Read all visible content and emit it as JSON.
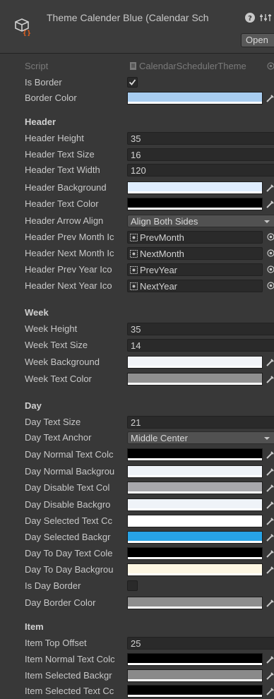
{
  "header": {
    "title": "Theme Calender Blue (Calendar Sch",
    "open_label": "Open",
    "icon": "script-asset-icon",
    "help_icon": "help-icon",
    "settings_icon": "presets-icon"
  },
  "script": {
    "label": "Script",
    "value": "CalendarSchedulerTheme"
  },
  "general": {
    "is_border": {
      "label": "Is Border",
      "checked": true
    },
    "border_color": {
      "label": "Border Color",
      "color": "#a8cdf0"
    }
  },
  "header_section": {
    "title": "Header",
    "header_height": {
      "label": "Header Height",
      "value": "35"
    },
    "header_text_size": {
      "label": "Header Text Size",
      "value": "16"
    },
    "header_text_width": {
      "label": "Header Text Width",
      "value": "120"
    },
    "header_background": {
      "label": "Header Background",
      "color": "#dfeefe"
    },
    "header_text_color": {
      "label": "Header Text Color",
      "color": "#000000"
    },
    "header_arrow_align": {
      "label": "Header Arrow Align",
      "value": "Align Both Sides"
    },
    "header_prev_month_icon": {
      "label": "Header Prev Month Ic",
      "value": "PrevMonth"
    },
    "header_next_month_icon": {
      "label": "Header Next Month Ic",
      "value": "NextMonth"
    },
    "header_prev_year_icon": {
      "label": "Header Prev Year Ico",
      "value": "PrevYear"
    },
    "header_next_year_icon": {
      "label": "Header Next Year Ico",
      "value": "NextYear"
    }
  },
  "week_section": {
    "title": "Week",
    "week_height": {
      "label": "Week Height",
      "value": "35"
    },
    "week_text_size": {
      "label": "Week Text Size",
      "value": "14"
    },
    "week_background": {
      "label": "Week Background",
      "color": "#f2f4f8"
    },
    "week_text_color": {
      "label": "Week Text Color",
      "color": "#909090"
    }
  },
  "day_section": {
    "title": "Day",
    "day_text_size": {
      "label": "Day Text Size",
      "value": "21"
    },
    "day_text_anchor": {
      "label": "Day Text Anchor",
      "value": "Middle Center"
    },
    "day_normal_text_color": {
      "label": "Day Normal Text Colc",
      "color": "#000000"
    },
    "day_normal_background": {
      "label": "Day Normal Backgrou",
      "color": "#eff3f8"
    },
    "day_disable_text_color": {
      "label": "Day Disable Text Col",
      "color": "#a8a8ac"
    },
    "day_disable_background": {
      "label": "Day Disable Backgro",
      "color": "#eff3f8"
    },
    "day_selected_text_color": {
      "label": "Day Selected Text Cc",
      "color": "#ffffff"
    },
    "day_selected_background": {
      "label": "Day Selected Backgr",
      "color": "#27a3e6"
    },
    "day_today_text_color": {
      "label": "Day To Day Text Cole",
      "color": "#000000"
    },
    "day_today_background": {
      "label": "Day To Day Backgrou",
      "color": "#fdf6e2"
    },
    "is_day_border": {
      "label": "Is Day Border",
      "checked": false
    },
    "day_border_color": {
      "label": "Day Border Color",
      "color": "#8e8e8e"
    }
  },
  "item_section": {
    "title": "Item",
    "item_top_offset": {
      "label": "Item Top Offset",
      "value": "25"
    },
    "item_normal_text_color": {
      "label": "Item Normal Text Colc",
      "color": "#000000"
    },
    "item_selected_background": {
      "label": "Item Selected Backgr",
      "color": "#8a8a8a"
    },
    "item_selected_text_color": {
      "label": "Item Selected Text Cc",
      "color": "#000000"
    }
  }
}
